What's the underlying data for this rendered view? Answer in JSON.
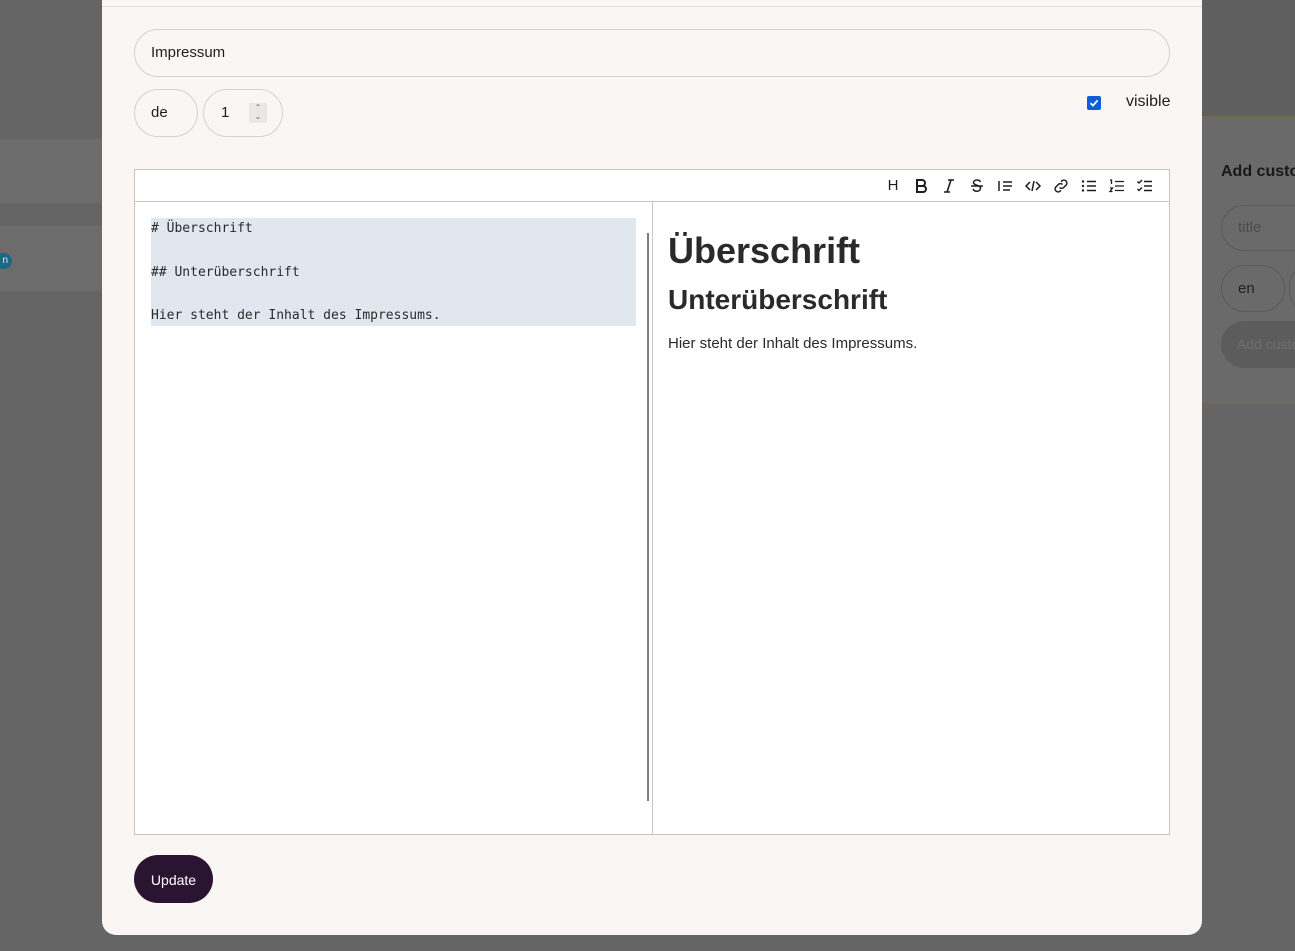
{
  "background": {
    "badge_text": "n",
    "panel": {
      "title": "Add custo",
      "title_placeholder": "title",
      "lang_value": "en",
      "add_button_label": "Add custo"
    }
  },
  "modal": {
    "title_value": "Impressum",
    "lang_value": "de",
    "order_value": "1",
    "visible_label": "visible",
    "visible_checked": true,
    "toolbar": {
      "icons": [
        "heading-icon",
        "bold-icon",
        "italic-icon",
        "strikethrough-icon",
        "quote-icon",
        "code-icon",
        "link-icon",
        "unordered-list-icon",
        "ordered-list-icon",
        "checklist-icon"
      ],
      "heading_glyph": "H"
    },
    "markdown": {
      "lines": [
        "# Überschrift",
        "",
        "## Unterüberschrift",
        "",
        "Hier steht der Inhalt des Impressums."
      ]
    },
    "preview": {
      "h1": "Überschrift",
      "h2": "Unterüberschrift",
      "paragraph": "Hier steht der Inhalt des Impressums."
    },
    "update_label": "Update"
  },
  "colors": {
    "accent": "#0b5ed7",
    "button_bg": "#2b1431",
    "modal_bg": "#faf6f3",
    "overlay": "#656565",
    "selection": "#e1e7ef"
  }
}
